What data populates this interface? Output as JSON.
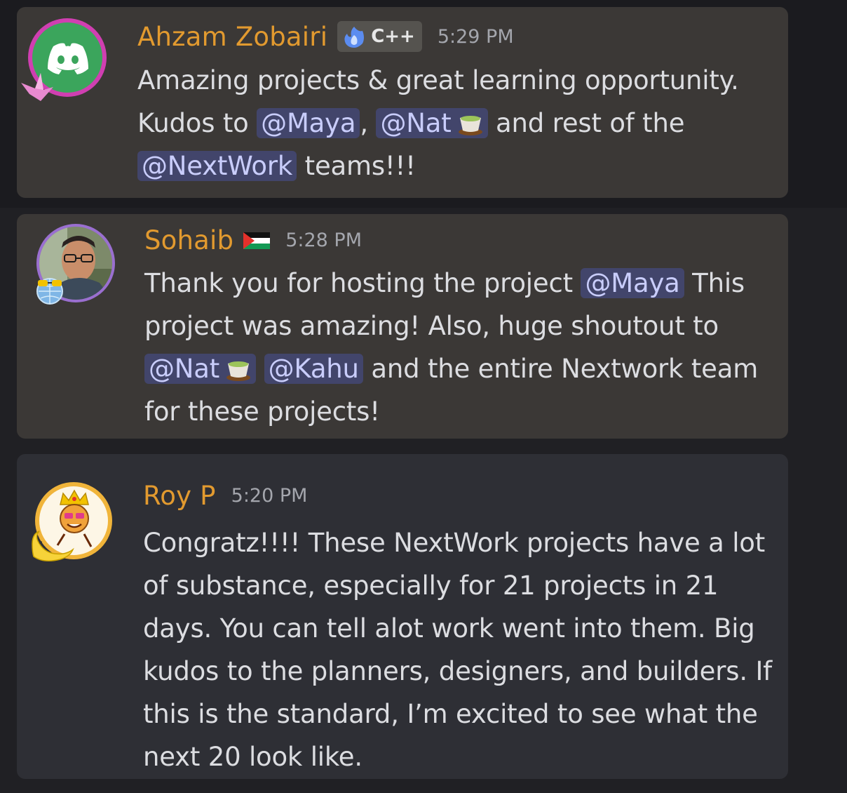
{
  "messages": [
    {
      "author": "Ahzam Zobairi",
      "tag": "C++",
      "time": "5:29 PM",
      "avatar_icon": "discord-logo-icon",
      "lines": [
        {
          "text1": "Amazing projects &  great learning opportunity."
        },
        {
          "text1": "Kudos to ",
          "mention1": "@Maya",
          "text2": ", ",
          "mention2": "@Nat",
          "text3": " and rest of the"
        },
        {
          "mention1": "@NextWork",
          "text1": " teams!!!"
        }
      ]
    },
    {
      "author": "Sohaib",
      "time": "5:28 PM",
      "avatar_icon": "user-photo-avatar",
      "lines": [
        {
          "text1": "Thank you for hosting the project ",
          "mention1": "@Maya",
          "text2": " This"
        },
        {
          "text1": "project was amazing! Also, huge shoutout to"
        },
        {
          "mention1": "@Nat",
          "mention2": "@Kahu",
          "text1": " and the entire Nextwork team"
        },
        {
          "text1": "for these projects!"
        }
      ]
    },
    {
      "author": "Roy P",
      "time": "5:20 PM",
      "avatar_icon": "king-emoji-avatar",
      "lines": [
        {
          "text1": "Congratz!!!! These NextWork projects have a lot"
        },
        {
          "text1": "of substance, especially for 21 projects in 21"
        },
        {
          "text1": "days. You can tell alot work went into them. Big"
        },
        {
          "text1": "kudos to the planners, designers, and builders. If"
        },
        {
          "text1": "this is the standard, I’m excited to see what the"
        },
        {
          "text1": "next 20 look like."
        }
      ]
    }
  ],
  "colors": {
    "name": "#e29a2f",
    "mention_bg": "#42456b",
    "mention_text": "#c9cdfb"
  }
}
